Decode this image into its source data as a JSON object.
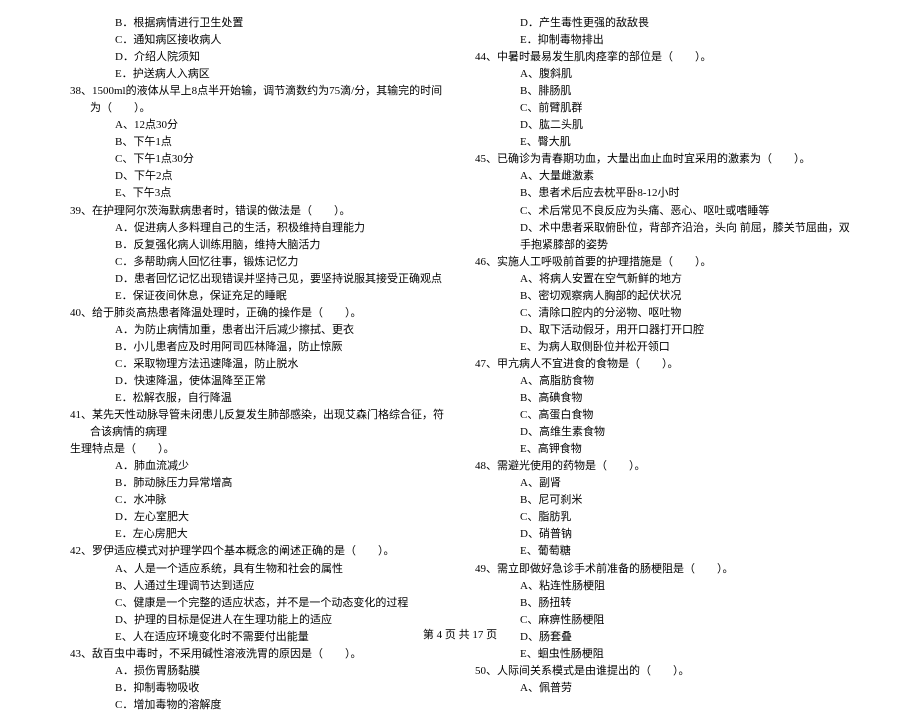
{
  "left": {
    "prelines": [
      "B．根据病情进行卫生处置",
      "C．通知病区接收病人",
      "D．介绍人院须知",
      "E．护送病人入病区"
    ],
    "q38": {
      "text": "38、1500ml的液体从早上8点半开始输，调节滴数约为75滴/分，其输完的时间为（　　）。",
      "options": [
        "A、12点30分",
        "B、下午1点",
        "C、下午1点30分",
        "D、下午2点",
        "E、下午3点"
      ]
    },
    "q39": {
      "text": "39、在护理阿尔茨海默病患者时，错误的做法是（　　）。",
      "options": [
        "A．促进病人多料理自己的生活，积极维持自理能力",
        "B．反复强化病人训练用脑，维持大脑活力",
        "C．多帮助病人回忆往事，锻炼记忆力",
        "D．患者回忆记忆出现错误并坚持己见，要坚持说服其接受正确观点",
        "E．保证夜间休息，保证充足的睡眠"
      ]
    },
    "q40": {
      "text": "40、给于肺炎高热患者降温处理时，正确的操作是（　　）。",
      "options": [
        "A．为防止病情加重，患者出汗后减少擦拭、更衣",
        "B．小儿患者应及时用阿司匹林降温，防止惊厥",
        "C．采取物理方法迅速降温，防止脱水",
        "D．快速降温，使体温降至正常",
        "E．松解衣服，自行降温"
      ]
    },
    "q41": {
      "text": "41、某先天性动脉导管未闭患儿反复发生肺部感染，出现艾森门格综合征，符合该病情的病理",
      "cont": "生理特点是（　　）。",
      "options": [
        "A．肺血流减少",
        "B．肺动脉压力异常增高",
        "C．水冲脉",
        "D．左心室肥大",
        "E．左心房肥大"
      ]
    },
    "q42": {
      "text": "42、罗伊适应模式对护理学四个基本概念的阐述正确的是（　　）。",
      "options": [
        "A、人是一个适应系统，具有生物和社会的属性",
        "B、人通过生理调节达到适应",
        "C、健康是一个完整的适应状态，并不是一个动态变化的过程",
        "D、护理的目标是促进人在生理功能上的适应",
        "E、人在适应环境变化时不需要付出能量"
      ]
    },
    "q43": {
      "text": "43、敌百虫中毒时，不采用碱性溶液洗胃的原因是（　　）。",
      "options": [
        "A．损伤胃肠黏膜",
        "B．抑制毒物吸收",
        "C．增加毒物的溶解度"
      ]
    }
  },
  "right": {
    "prelines": [
      "D．产生毒性更强的敌敌畏",
      "E．抑制毒物排出"
    ],
    "q44": {
      "text": "44、中暑时最易发生肌肉痉挛的部位是（　　）。",
      "options": [
        "A、腹斜肌",
        "B、腓肠肌",
        "C、前臂肌群",
        "D、肱二头肌",
        "E、臀大肌"
      ]
    },
    "q45": {
      "text": "45、已确诊为青春期功血，大量出血止血时宜采用的激素为（　　）。",
      "options": [
        "A、大量雌激素",
        "B、患者术后应去枕平卧8-12小时",
        "C、术后常见不良反应为头痛、恶心、呕吐或嗜睡等",
        "D、术中患者采取俯卧位，背部齐沿治，头向 前屈，膝关节屈曲，双手抱紧膝部的姿势"
      ]
    },
    "q46": {
      "text": "46、实施人工呼吸前首要的护理措施是（　　）。",
      "options": [
        "A、将病人安置在空气新鲜的地方",
        "B、密切观察病人胸部的起伏状况",
        "C、清除口腔内的分泌物、呕吐物",
        "D、取下活动假牙，用开口器打开口腔",
        "E、为病人取侧卧位并松开领口"
      ]
    },
    "q47": {
      "text": "47、甲亢病人不宜进食的食物是（　　）。",
      "options": [
        "A、高脂肪食物",
        "B、高碘食物",
        "C、高蛋白食物",
        "D、高维生素食物",
        "E、高钾食物"
      ]
    },
    "q48": {
      "text": "48、需避光使用的药物是（　　）。",
      "options": [
        "A、副肾",
        "B、尼可刹米",
        "C、脂肪乳",
        "D、硝普钠",
        "E、葡萄糖"
      ]
    },
    "q49": {
      "text": "49、需立即做好急诊手术前准备的肠梗阻是（　　）。",
      "options": [
        "A、粘连性肠梗阻",
        "B、肠扭转",
        "C、麻痹性肠梗阻",
        "D、肠套叠",
        "E、蛔虫性肠梗阻"
      ]
    },
    "q50": {
      "text": "50、人际间关系模式是由谁提出的（　　）。",
      "options": [
        "A、佩普劳"
      ]
    }
  },
  "footer": "第 4 页 共 17 页"
}
